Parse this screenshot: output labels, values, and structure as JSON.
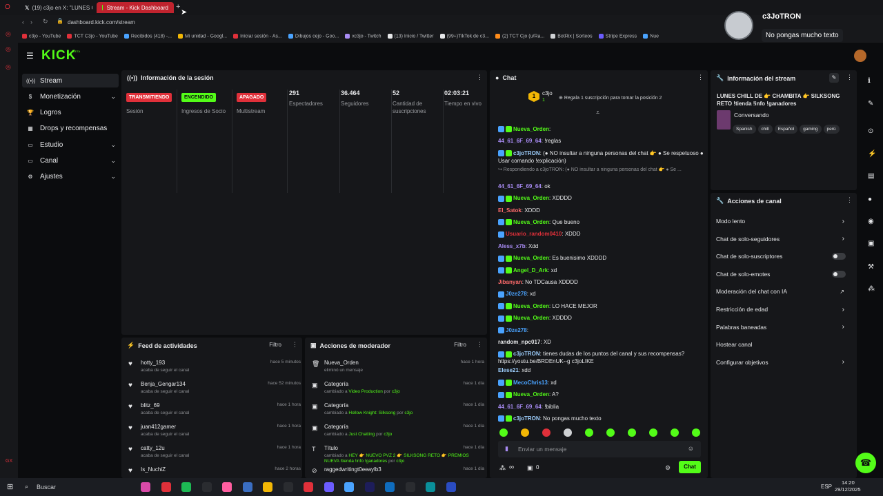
{
  "browser": {
    "tabs": [
      {
        "label": "(19) c3jo en X: \"LUNES CH"
      },
      {
        "label": "Stream - Kick Dashboard"
      }
    ],
    "new_tab": "+",
    "url": "dashboard.kick.com/stream",
    "bookmarks": [
      "c3jo - YouTube",
      "TCT C3jo - YouTube",
      "Recibidos (418) -...",
      "Mi unidad - Googl...",
      "Iniciar sesión - As...",
      "Dibujos cejo - Goo...",
      "xc3jo - Twitch",
      "(13) Inicio / Twitter",
      "(99+)TikTok de c3...",
      "(2) TCT Cjo (u/Ra...",
      "BotRix | Sorteos",
      "Stripe Express",
      "Nue"
    ]
  },
  "popup": {
    "name": "c3JoTRON",
    "message": "No pongas mucho texto"
  },
  "brand": {
    "logo": "KICK",
    "beta": "BETA"
  },
  "nav": {
    "items": [
      {
        "label": "Stream",
        "icon": "stream-icon",
        "chevron": false
      },
      {
        "label": "Monetización",
        "icon": "money-icon",
        "chevron": true
      },
      {
        "label": "Logros",
        "icon": "trophy-icon",
        "chevron": false
      },
      {
        "label": "Drops y recompensas",
        "icon": "drops-icon",
        "chevron": false
      },
      {
        "label": "Estudio",
        "icon": "studio-icon",
        "chevron": true
      },
      {
        "label": "Canal",
        "icon": "channel-icon",
        "chevron": true
      },
      {
        "label": "Ajustes",
        "icon": "gear-icon",
        "chevron": true
      }
    ]
  },
  "session": {
    "title": "Información de la sesión",
    "badges": [
      {
        "text": "TRANSMITIENDO",
        "label": "Sesión",
        "bg": "#e0303a",
        "fg": "#ffffff"
      },
      {
        "text": "ENCENDIDO",
        "label": "Ingresos de Socio",
        "bg": "#53fc18",
        "fg": "#0b0c0e"
      },
      {
        "text": "APAGADO",
        "label": "Multistream",
        "bg": "#e0303a",
        "fg": "#ffffff"
      }
    ],
    "stats": [
      {
        "value": "291",
        "label": "Espectadores"
      },
      {
        "value": "36.464",
        "label": "Seguidores"
      },
      {
        "value": "52",
        "label": "Cantidad de suscripciones"
      },
      {
        "value": "02:03:21",
        "label": "Tiempo en vivo"
      }
    ]
  },
  "feed": {
    "title": "Feed de actividades",
    "filter": "Filtro",
    "items": [
      {
        "name": "hotty_193",
        "sub": "acaba de seguir el canal",
        "time": "hace 5 minutos"
      },
      {
        "name": "Benja_Gengar134",
        "sub": "acaba de seguir el canal",
        "time": "hace 52 minutos"
      },
      {
        "name": "blitz_69",
        "sub": "acaba de seguir el canal",
        "time": "hace 1 hora"
      },
      {
        "name": "juan412gamer",
        "sub": "acaba de seguir el canal",
        "time": "hace 1 hora"
      },
      {
        "name": "catty_12u",
        "sub": "acaba de seguir el canal",
        "time": "hace 1 hora"
      },
      {
        "name": "Is_NuchiZ",
        "sub": "",
        "time": "hace 2 horas"
      }
    ]
  },
  "mod": {
    "title": "Acciones de moderador",
    "filter": "Filtro",
    "items": [
      {
        "name": "Nueva_Orden",
        "pre": "eliminó un mensaje",
        "hl": "",
        "mid": "",
        "by": "",
        "time": "hace 1 hora",
        "icon": "trash-icon"
      },
      {
        "name": "Categoría",
        "pre": "cambiado a ",
        "hl": "Video Production",
        "mid": " por ",
        "by": "c3jo",
        "time": "hace 1 día",
        "icon": "category-icon"
      },
      {
        "name": "Categoría",
        "pre": "cambiado a ",
        "hl": "Hollow Knight: Silksong",
        "mid": " por ",
        "by": "c3jo",
        "time": "hace 1 día",
        "icon": "category-icon"
      },
      {
        "name": "Categoría",
        "pre": "cambiado a ",
        "hl": "Just Chatting",
        "mid": " por ",
        "by": "c3jo",
        "time": "hace 1 día",
        "icon": "category-icon"
      },
      {
        "name": "Título",
        "pre": "cambiado a ",
        "hl": "HEY 👉 NUEVO PVZ 2 👉 SILKSONG RETO 👉 PREMIOS NUEVA !tienda !info !ganadores",
        "mid": " por ",
        "by": "c3jo",
        "time": "hace 1 día",
        "icon": "title-icon"
      },
      {
        "name": "raggedwritingt0eeaylb3",
        "pre": "",
        "hl": "",
        "mid": "",
        "by": "",
        "time": "hace 1 día",
        "icon": "ban-icon"
      }
    ]
  },
  "chat": {
    "title": "Chat",
    "pinned": {
      "user": "c3jo",
      "count": "1",
      "gift_text": "Regala 1 suscripción para tomar la posición 2"
    },
    "messages": [
      {
        "user": "Nueva_Orden",
        "color": "#53fc18",
        "text": "",
        "badges": 2
      },
      {
        "user": "44_61_6F_69_64",
        "color": "#a98cf5",
        "text": "!reglas",
        "badges": 0
      },
      {
        "user": "c3joTRON",
        "color": "#9fd0ff",
        "text": "(● NO insultar a ninguna personas del chat 👉 ● Se respetuoso ● Usar comando !explicación)",
        "badges": 2
      },
      {
        "user": "",
        "color": "#8f9195",
        "text": "↪ Respondiendo a c3joTRON: (● NO insultar a ninguna personas del chat 👉 ● Se ...",
        "badges": 0
      },
      {
        "user": "44_61_6F_69_64",
        "color": "#a98cf5",
        "text": "ok",
        "badges": 0
      },
      {
        "user": "Nueva_Orden",
        "color": "#53fc18",
        "text": "XDDDD",
        "badges": 2
      },
      {
        "user": "El_Satok",
        "color": "#ff6b6b",
        "text": "XDDD",
        "badges": 0
      },
      {
        "user": "Nueva_Orden",
        "color": "#53fc18",
        "text": "Que bueno",
        "badges": 2
      },
      {
        "user": "Usuario_random0410",
        "color": "#e0303a",
        "text": "XDDD",
        "badges": 1
      },
      {
        "user": "Aless_x7b",
        "color": "#a98cf5",
        "text": "Xdd",
        "badges": 0
      },
      {
        "user": "Nueva_Orden",
        "color": "#53fc18",
        "text": "Es buenisimo XDDDD",
        "badges": 2
      },
      {
        "user": "Angel_D_Ark",
        "color": "#53fc18",
        "text": "xd",
        "badges": 2
      },
      {
        "user": "Jibanyan",
        "color": "#ff6b6b",
        "text": "No TDCausa XDDDD",
        "badges": 0
      },
      {
        "user": "J0ze278",
        "color": "#4aa3ff",
        "text": "xd",
        "badges": 1
      },
      {
        "user": "Nueva_Orden",
        "color": "#53fc18",
        "text": "LO HACE MEJOR",
        "badges": 2
      },
      {
        "user": "Nueva_Orden",
        "color": "#53fc18",
        "text": "XDDDD",
        "badges": 2
      },
      {
        "user": "J0ze278",
        "color": "#4aa3ff",
        "text": "",
        "badges": 1
      },
      {
        "user": "random_npc017",
        "color": "#e6e7e9",
        "text": "XD",
        "badges": 0
      },
      {
        "user": "c3joTRON",
        "color": "#9fd0ff",
        "text": "tienes dudas de los puntos del canal y sus recompensas? https://youtu.be/BRDEnUK--g c3joLIKE",
        "badges": 2
      },
      {
        "user": "Elese21",
        "color": "#9fd0ff",
        "text": "xdd",
        "badges": 0
      },
      {
        "user": "MecoChris13",
        "color": "#4aa3ff",
        "text": "xd",
        "badges": 2
      },
      {
        "user": "Nueva_Orden",
        "color": "#53fc18",
        "text": "A?",
        "badges": 2
      },
      {
        "user": "44_61_6F_69_64",
        "color": "#a98cf5",
        "text": "!biblia",
        "badges": 0
      },
      {
        "user": "c3joTRON",
        "color": "#9fd0ff",
        "text": "No pongas mucho texto",
        "badges": 2
      }
    ],
    "placeholder": "Enviar un mensaje",
    "points": "∞",
    "gift_count": "0",
    "send": "Chat"
  },
  "stream_info": {
    "title": "Información del stream",
    "stream_title": "LUNES CHILL DE 👉 CHAMBITA 👉 SILKSONG RETO !tienda !info !ganadores",
    "category": "Conversando",
    "tags": [
      "Spanish",
      "chill",
      "Español",
      "gaming",
      "perú"
    ]
  },
  "channel_actions": {
    "title": "Acciones de canal",
    "items": [
      {
        "label": "Modo lento",
        "ctl": "chevron"
      },
      {
        "label": "Chat de solo-seguidores",
        "ctl": "chevron"
      },
      {
        "label": "Chat de solo-suscriptores",
        "ctl": "toggle"
      },
      {
        "label": "Chat de solo-emotes",
        "ctl": "toggle"
      },
      {
        "label": "Moderación del chat con IA",
        "ctl": "external"
      },
      {
        "label": "Restricción de edad",
        "ctl": "chevron"
      },
      {
        "label": "Palabras baneadas",
        "ctl": "chevron"
      },
      {
        "label": "Hostear canal",
        "ctl": "none"
      },
      {
        "label": "Configurar objetivos",
        "ctl": "chevron"
      }
    ]
  },
  "taskbar": {
    "search": "Buscar",
    "lang": "ESP",
    "time": "14:20",
    "date": "29/12/2025"
  },
  "colors": {
    "accent": "#53fc18",
    "live": "#e0303a",
    "panel": "#16171a",
    "bg": "#0b0c0e"
  }
}
